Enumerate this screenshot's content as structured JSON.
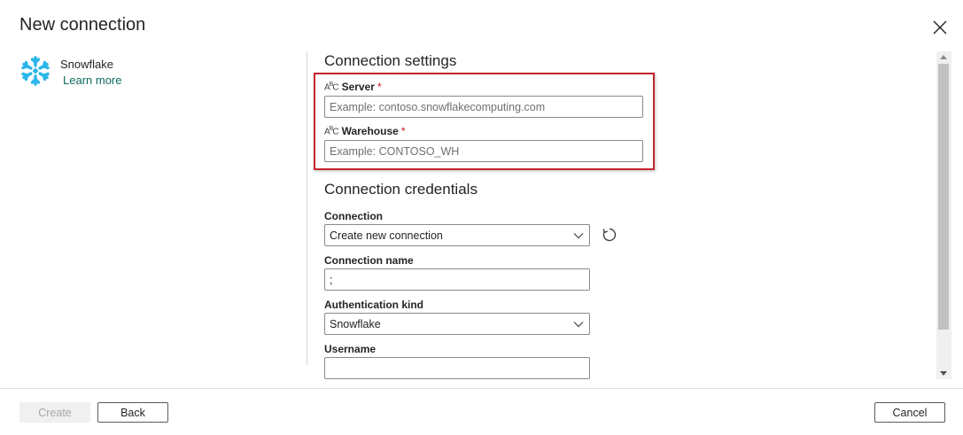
{
  "dialog": {
    "title": "New connection"
  },
  "connector": {
    "name": "Snowflake",
    "learn_more": "Learn more",
    "icon": "snowflake-icon",
    "brand_color": "#29b5e8"
  },
  "settings": {
    "title": "Connection settings",
    "server": {
      "label": "Server",
      "required_mark": "*",
      "placeholder": "Example: contoso.snowflakecomputing.com"
    },
    "warehouse": {
      "label": "Warehouse",
      "required_mark": "*",
      "placeholder": "Example: CONTOSO_WH"
    },
    "highlight_color": "#c4262e"
  },
  "credentials": {
    "title": "Connection credentials",
    "connection": {
      "label": "Connection",
      "selected": "Create new connection"
    },
    "connection_name": {
      "label": "Connection name",
      "value": ";"
    },
    "auth_kind": {
      "label": "Authentication kind",
      "selected": "Snowflake"
    },
    "username": {
      "label": "Username",
      "value": ""
    }
  },
  "footer": {
    "create_label": "Create",
    "back_label": "Back",
    "cancel_label": "Cancel"
  }
}
